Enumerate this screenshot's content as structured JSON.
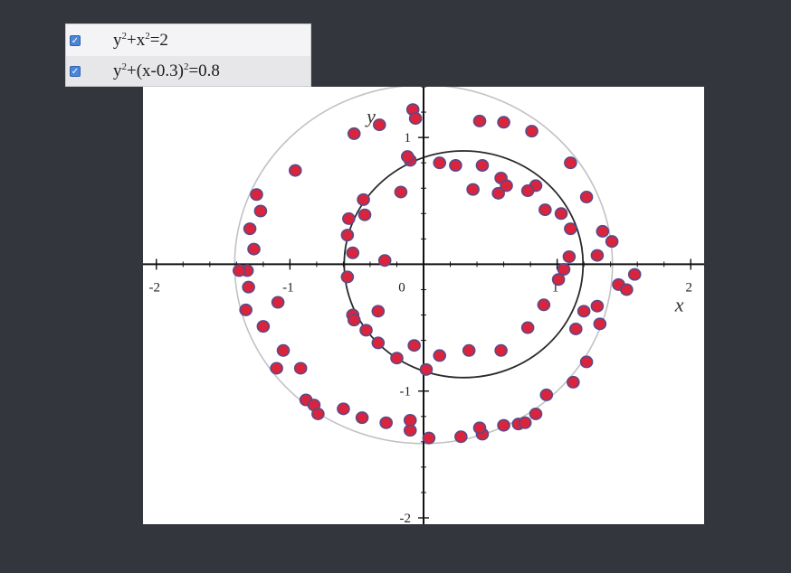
{
  "legend": {
    "items": [
      {
        "parts": [
          "y",
          "2",
          "+x",
          "2",
          "=2"
        ]
      },
      {
        "parts": [
          "y",
          "2",
          "+(x-0.3)",
          "2",
          "=0.8"
        ]
      }
    ]
  },
  "chart_data": {
    "type": "scatter",
    "xlabel": "x",
    "ylabel": "y",
    "xlim": [
      -2.1,
      2.1
    ],
    "ylim": [
      -2.05,
      1.4
    ],
    "x_ticks": [
      -2,
      -1,
      0,
      1,
      2
    ],
    "x_tick_labels": [
      "-2",
      "-1",
      "0",
      "1",
      "2"
    ],
    "y_ticks": [
      -2,
      -1,
      1
    ],
    "y_tick_labels": [
      "-2",
      "-1",
      "1"
    ],
    "grid": false,
    "legend_position": "top-left",
    "curves": [
      {
        "type": "circle",
        "cx": 0,
        "cy": 0,
        "r": 1.414,
        "color": "#c2c2c6"
      },
      {
        "type": "circle",
        "cx": 0.3,
        "cy": 0,
        "r": 0.894,
        "color": "#2a2a2a"
      }
    ],
    "series": [
      {
        "color": "#d9243c",
        "edge": "#5a4a8a",
        "points": [
          [
            -0.08,
            1.22
          ],
          [
            -0.06,
            1.15
          ],
          [
            -0.33,
            1.1
          ],
          [
            -0.52,
            1.03
          ],
          [
            -0.96,
            0.74
          ],
          [
            -1.25,
            0.55
          ],
          [
            -1.22,
            0.42
          ],
          [
            -1.3,
            0.28
          ],
          [
            -1.27,
            0.12
          ],
          [
            -1.32,
            -0.05
          ],
          [
            -1.38,
            -0.05
          ],
          [
            -1.31,
            -0.18
          ],
          [
            -1.33,
            -0.36
          ],
          [
            -1.2,
            -0.49
          ],
          [
            -1.09,
            -0.3
          ],
          [
            -1.05,
            -0.68
          ],
          [
            -1.1,
            -0.82
          ],
          [
            -0.92,
            -0.82
          ],
          [
            -0.88,
            -1.07
          ],
          [
            -0.82,
            -1.11
          ],
          [
            -0.79,
            -1.18
          ],
          [
            -0.6,
            -1.14
          ],
          [
            -0.46,
            -1.21
          ],
          [
            -0.28,
            -1.25
          ],
          [
            -0.1,
            -1.31
          ],
          [
            -0.1,
            -1.23
          ],
          [
            0.04,
            -1.37
          ],
          [
            0.28,
            -1.36
          ],
          [
            0.44,
            -1.34
          ],
          [
            0.42,
            -1.29
          ],
          [
            0.6,
            -1.27
          ],
          [
            0.71,
            -1.26
          ],
          [
            0.76,
            -1.25
          ],
          [
            0.84,
            -1.18
          ],
          [
            0.92,
            -1.03
          ],
          [
            1.12,
            -0.93
          ],
          [
            1.22,
            -0.77
          ],
          [
            1.14,
            -0.51
          ],
          [
            1.2,
            -0.37
          ],
          [
            1.3,
            -0.33
          ],
          [
            1.32,
            -0.47
          ],
          [
            1.46,
            -0.16
          ],
          [
            1.52,
            -0.2
          ],
          [
            1.58,
            -0.08
          ],
          [
            1.3,
            0.07
          ],
          [
            1.41,
            0.18
          ],
          [
            1.34,
            0.26
          ],
          [
            1.22,
            0.53
          ],
          [
            1.1,
            0.8
          ],
          [
            0.81,
            1.05
          ],
          [
            0.6,
            1.12
          ],
          [
            0.42,
            1.13
          ],
          [
            -0.1,
            0.82
          ],
          [
            0.12,
            0.8
          ],
          [
            0.24,
            0.78
          ],
          [
            0.44,
            0.78
          ],
          [
            0.58,
            0.68
          ],
          [
            0.84,
            0.62
          ],
          [
            0.78,
            0.58
          ],
          [
            0.91,
            0.43
          ],
          [
            1.03,
            0.4
          ],
          [
            1.1,
            0.28
          ],
          [
            1.09,
            0.06
          ],
          [
            1.05,
            -0.04
          ],
          [
            1.01,
            -0.12
          ],
          [
            0.9,
            -0.32
          ],
          [
            0.78,
            -0.5
          ],
          [
            0.58,
            -0.68
          ],
          [
            0.34,
            -0.68
          ],
          [
            0.12,
            -0.72
          ],
          [
            0.02,
            -0.83
          ],
          [
            -0.2,
            -0.74
          ],
          [
            -0.34,
            -0.62
          ],
          [
            -0.43,
            -0.52
          ],
          [
            -0.53,
            -0.4
          ],
          [
            -0.57,
            -0.1
          ],
          [
            -0.53,
            0.09
          ],
          [
            -0.57,
            0.23
          ],
          [
            -0.44,
            0.39
          ],
          [
            -0.56,
            0.36
          ],
          [
            -0.45,
            0.51
          ],
          [
            -0.17,
            0.57
          ],
          [
            -0.12,
            0.85
          ],
          [
            -0.34,
            -0.37
          ],
          [
            -0.29,
            0.03
          ],
          [
            -0.52,
            -0.44
          ],
          [
            -0.07,
            -0.64
          ],
          [
            0.37,
            0.59
          ],
          [
            0.62,
            0.62
          ],
          [
            0.56,
            0.56
          ]
        ]
      }
    ]
  }
}
